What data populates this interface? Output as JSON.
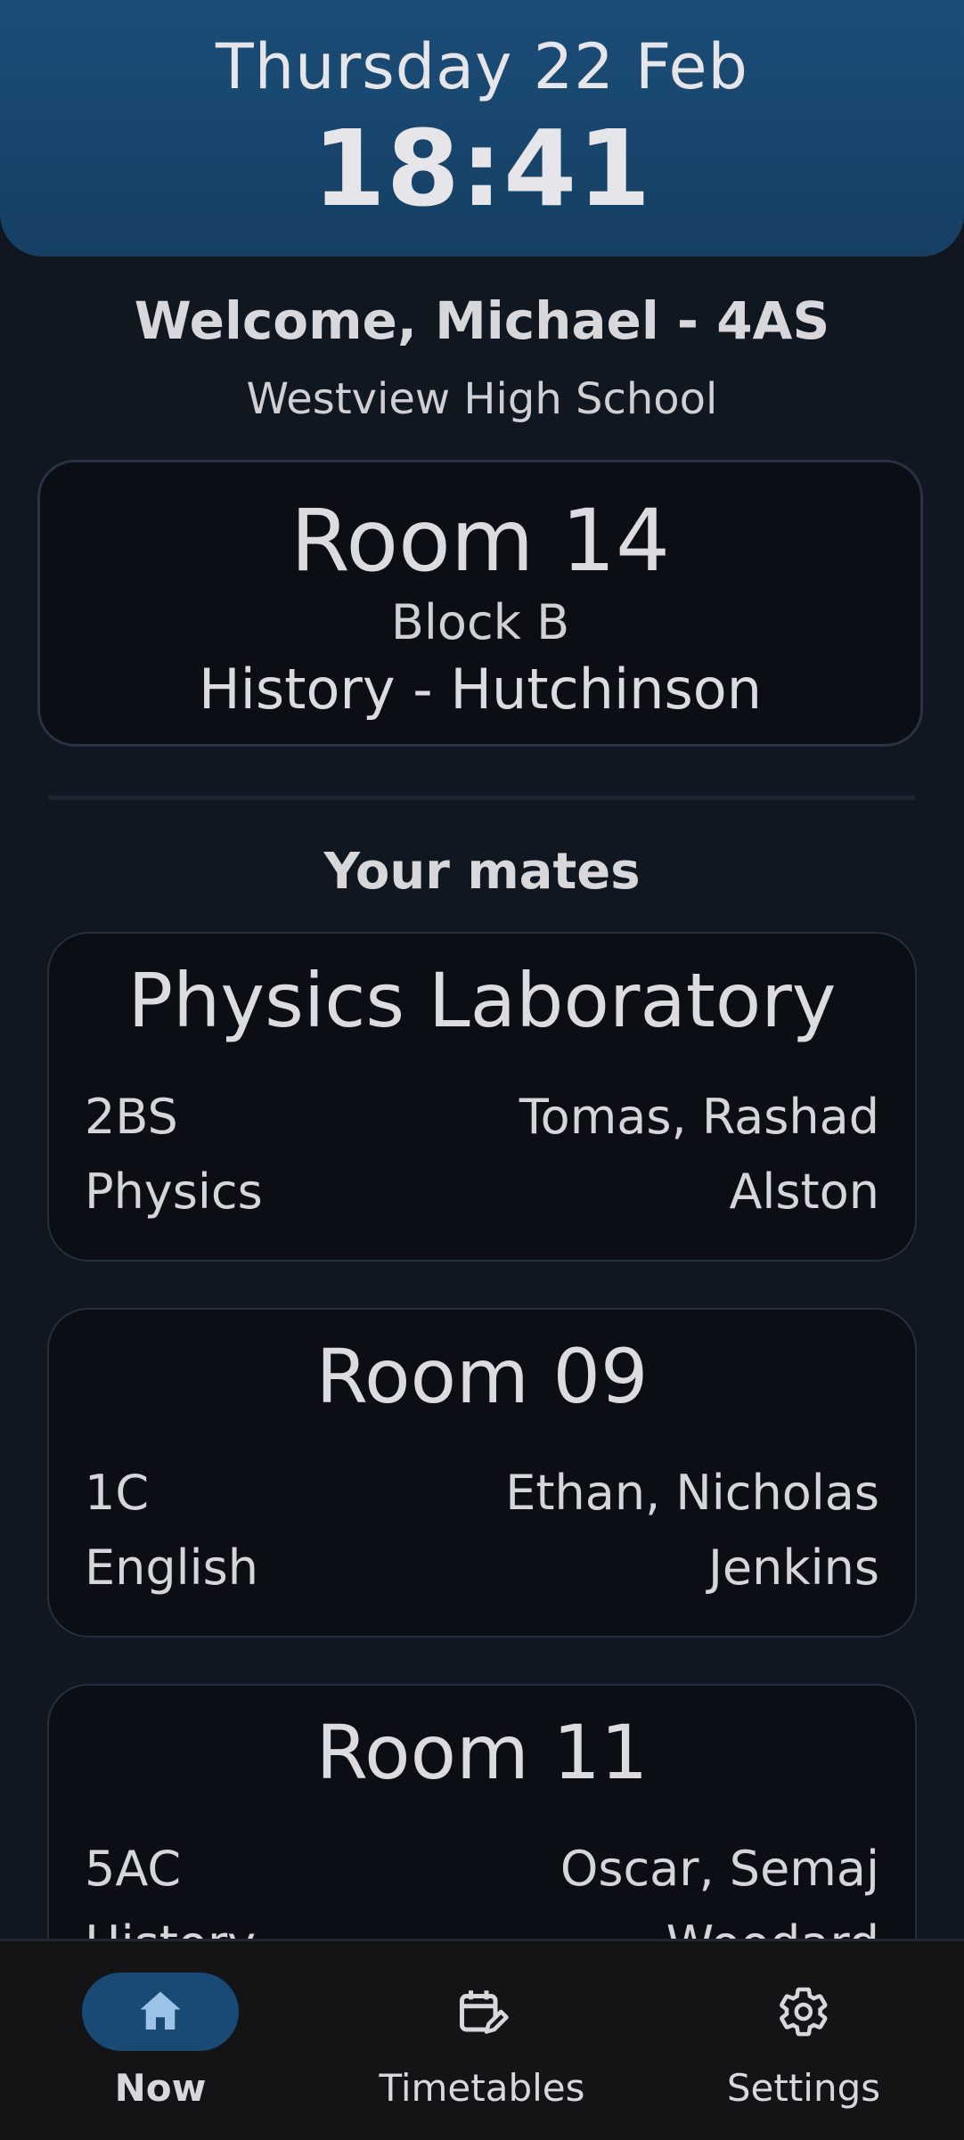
{
  "header": {
    "date": "Thursday 22 Feb",
    "time": "18:41"
  },
  "welcome": "Welcome, Michael - 4AS",
  "school": "Westview High School",
  "current": {
    "room": "Room 14",
    "block": "Block B",
    "subject": "History - Hutchinson"
  },
  "mates_title": "Your mates",
  "mates": [
    {
      "room": "Physics Laboratory",
      "class": "2BS",
      "names": "Tomas, Rashad",
      "subject": "Physics",
      "teacher": "Alston"
    },
    {
      "room": "Room 09",
      "class": "1C",
      "names": "Ethan, Nicholas",
      "subject": "English",
      "teacher": "Jenkins"
    },
    {
      "room": "Room 11",
      "class": "5AC",
      "names": "Oscar, Semaj",
      "subject": "History",
      "teacher": "Woodard"
    }
  ],
  "nav": [
    {
      "label": "Now",
      "icon": "home-icon",
      "active": true
    },
    {
      "label": "Timetables",
      "icon": "calendar-edit-icon",
      "active": false
    },
    {
      "label": "Settings",
      "icon": "gear-icon",
      "active": false
    }
  ],
  "colors": {
    "background": "#111720",
    "header": "#1b4d78",
    "card": "#0b0e14",
    "nav_active": "#184a75",
    "nav_bar": "#141416"
  }
}
